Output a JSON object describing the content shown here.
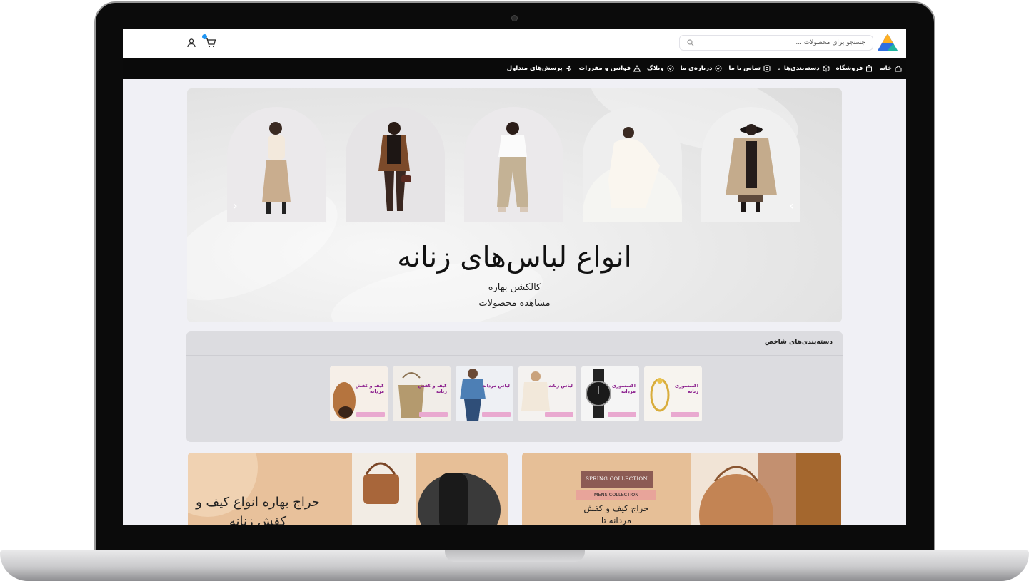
{
  "header": {
    "search_placeholder": "جستجو برای محصولات ...",
    "cart_count": ""
  },
  "nav": {
    "items": [
      {
        "label": "خانه",
        "icon": "home-icon"
      },
      {
        "label": "فروشگاه",
        "icon": "shopping-bag-icon"
      },
      {
        "label": "دسته‌بندی‌ها",
        "icon": "box-icon",
        "has_dropdown": true
      },
      {
        "label": "تماس با ما",
        "icon": "phone-icon"
      },
      {
        "label": "درباره‌ی ما",
        "icon": "check-circle-icon"
      },
      {
        "label": "وبلاگ",
        "icon": "check-circle-icon"
      },
      {
        "label": "قوانین و مقررات",
        "icon": "warning-icon"
      },
      {
        "label": "پرسش‌های متداول",
        "icon": "bolt-icon"
      }
    ]
  },
  "hero": {
    "title": "انواع لباس‌های زنانه",
    "subtitle": "کالکشن بهاره",
    "cta": "مشاهده محصولات"
  },
  "categories": {
    "title": "دسته‌بندی‌های شاخص",
    "items": [
      {
        "label": "کیف و کفش مردانه"
      },
      {
        "label": "کیف و کفش زنانه"
      },
      {
        "label": "لباس مردانه"
      },
      {
        "label": "لباس زنانه"
      },
      {
        "label": "اکسسوری مردانه"
      },
      {
        "label": "اکسسوری زنانه"
      }
    ]
  },
  "promos": {
    "left_text": "حراج بهاره انواع کیف و کفش زنانه",
    "right_spring": "SPRING COLLECTION",
    "right_mens": "MENS COLLECTION",
    "right_text": "حراج کیف و کفش مردانه تا"
  },
  "colors": {
    "navbar": "#0a0a0a",
    "cart_badge": "#2196f3",
    "category_label": "#8a1c8c",
    "promo_bg": "#e8bf97"
  }
}
